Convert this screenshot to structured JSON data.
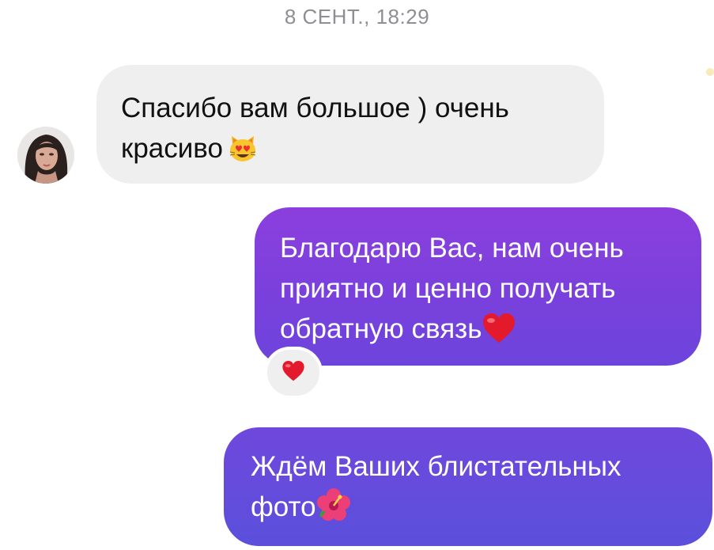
{
  "conversation": {
    "timestamp": "8 СЕНТ., 18:29",
    "messages": [
      {
        "direction": "incoming",
        "lines": [
          "Спасибо вам большое ) очень",
          "красиво"
        ],
        "emoji": "heart-eyes-cat-icon"
      },
      {
        "direction": "outgoing",
        "lines": [
          "Благодарю Вас, нам очень",
          "приятно и ценно получать",
          "обратную связь"
        ],
        "emoji": "red-heart-icon",
        "reaction": "red-heart-icon"
      },
      {
        "direction": "outgoing",
        "lines": [
          "Ждём Ваших блистательных",
          "фото"
        ],
        "emoji": "hibiscus-icon"
      }
    ]
  },
  "colors": {
    "incoming_bubble": "#efeff0",
    "outgoing_gradient_start": "#8b3fdd",
    "outgoing_gradient_end": "#5b4fdc",
    "timestamp_text": "#8e8e93"
  }
}
